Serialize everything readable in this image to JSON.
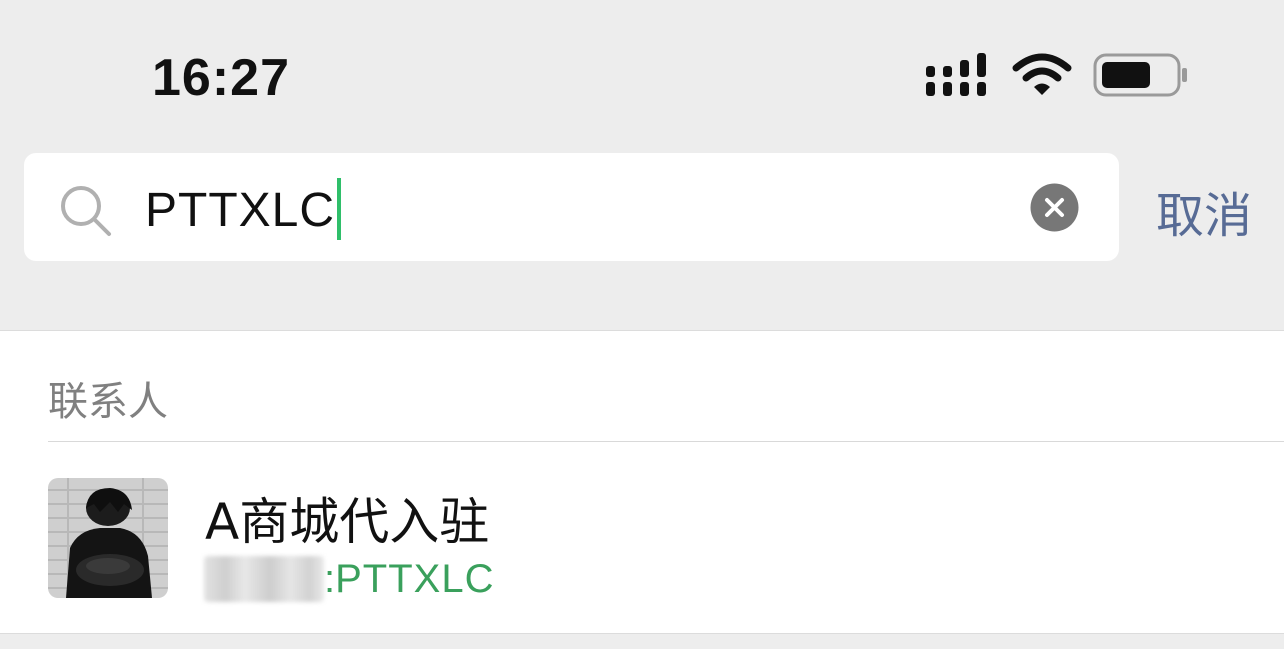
{
  "status_bar": {
    "time": "16:27",
    "icons": [
      "signal-icon",
      "wifi-icon",
      "battery-icon"
    ]
  },
  "search": {
    "value": "PTTXLC",
    "cancel_label": "取消",
    "icons": [
      "search-icon",
      "clear-icon"
    ]
  },
  "results": {
    "section_title": "联系人",
    "items": [
      {
        "name": "A商城代入驻",
        "detail_separator": ":",
        "detail_match": "PTTXLC",
        "avatar": "avatar-photo"
      }
    ]
  },
  "colors": {
    "background": "#ededed",
    "accent_green": "#3aa05c",
    "caret_green": "#2fbf6a",
    "link_blue": "#576b95"
  }
}
